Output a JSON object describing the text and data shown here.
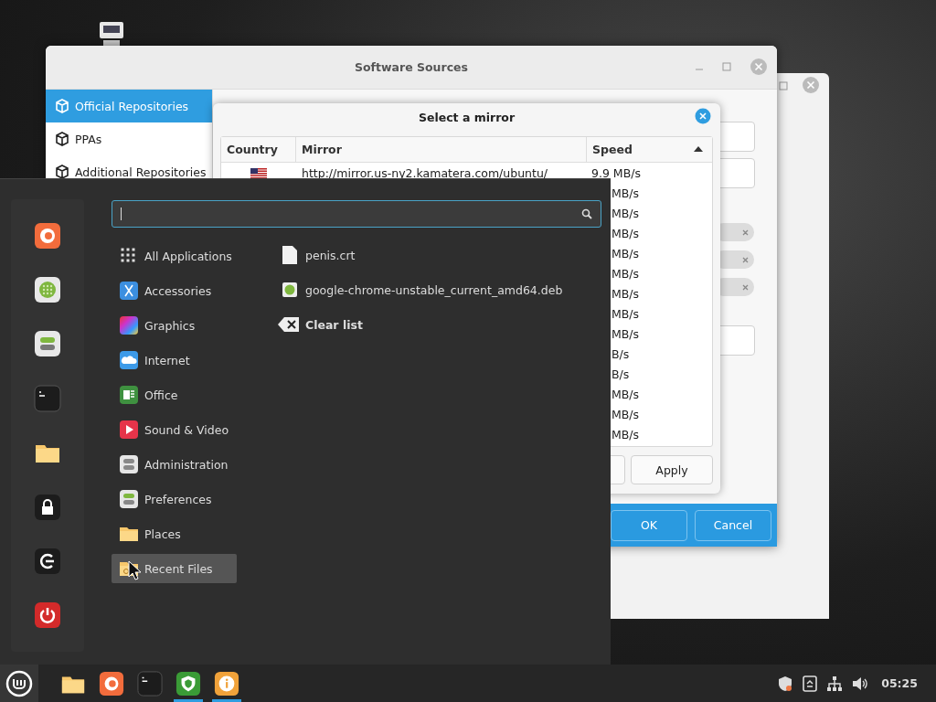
{
  "software_sources": {
    "title": "Software Sources",
    "sidebar": [
      {
        "label": "Official Repositories",
        "selected": true
      },
      {
        "label": "PPAs",
        "selected": false
      },
      {
        "label": "Additional Repositories",
        "selected": false
      }
    ],
    "toggles": [
      {
        "on": false
      },
      {
        "on": false
      },
      {
        "on": false
      }
    ],
    "buttons": [
      "OK",
      "Cancel"
    ]
  },
  "mirror_dialog": {
    "title": "Select a mirror",
    "columns": [
      "Country",
      "Mirror",
      "Speed"
    ],
    "rows": [
      {
        "mirror": "http://mirror.us-ny2.kamatera.com/ubuntu/",
        "speed": "9.9 MB/s"
      },
      {
        "speed": "MB/s"
      },
      {
        "speed": "MB/s"
      },
      {
        "speed": "MB/s"
      },
      {
        "speed": "MB/s"
      },
      {
        "speed": "MB/s"
      },
      {
        "speed": "MB/s"
      },
      {
        "speed": "MB/s"
      },
      {
        "speed": "MB/s"
      },
      {
        "speed": "B/s"
      },
      {
        "speed": "B/s"
      },
      {
        "speed": "MB/s"
      },
      {
        "speed": "MB/s"
      },
      {
        "speed": "MB/s"
      }
    ],
    "buttons": [
      "Apply"
    ]
  },
  "menu": {
    "favorites": [
      {
        "kind": "firefox"
      },
      {
        "kind": "software"
      },
      {
        "kind": "settings"
      },
      {
        "kind": "terminal"
      },
      {
        "kind": "folder"
      },
      {
        "kind": "lock"
      },
      {
        "kind": "logout"
      },
      {
        "kind": "power"
      }
    ],
    "categories": [
      {
        "label": "All Applications",
        "kind": "grid",
        "selected": false
      },
      {
        "label": "Accessories",
        "kind": "accessories",
        "selected": false
      },
      {
        "label": "Graphics",
        "kind": "graphics",
        "selected": false
      },
      {
        "label": "Internet",
        "kind": "internet",
        "selected": false
      },
      {
        "label": "Office",
        "kind": "office",
        "selected": false
      },
      {
        "label": "Sound & Video",
        "kind": "media",
        "selected": false
      },
      {
        "label": "Administration",
        "kind": "admin",
        "selected": false
      },
      {
        "label": "Preferences",
        "kind": "prefs",
        "selected": false
      },
      {
        "label": "Places",
        "kind": "folder",
        "selected": false
      },
      {
        "label": "Recent Files",
        "kind": "recent",
        "selected": true
      }
    ],
    "recent": [
      {
        "label": "penis.crt",
        "kind": "file"
      },
      {
        "label": "google-chrome-unstable_current_amd64.deb",
        "kind": "package"
      },
      {
        "label": "Clear list",
        "kind": "clear"
      }
    ]
  },
  "taskbar": {
    "launchers": [
      {
        "kind": "folder",
        "running": false
      },
      {
        "kind": "firefox",
        "running": false
      },
      {
        "kind": "terminal",
        "running": false
      },
      {
        "kind": "shield",
        "running": true
      },
      {
        "kind": "info",
        "running": true
      }
    ],
    "clock": "05:25"
  }
}
